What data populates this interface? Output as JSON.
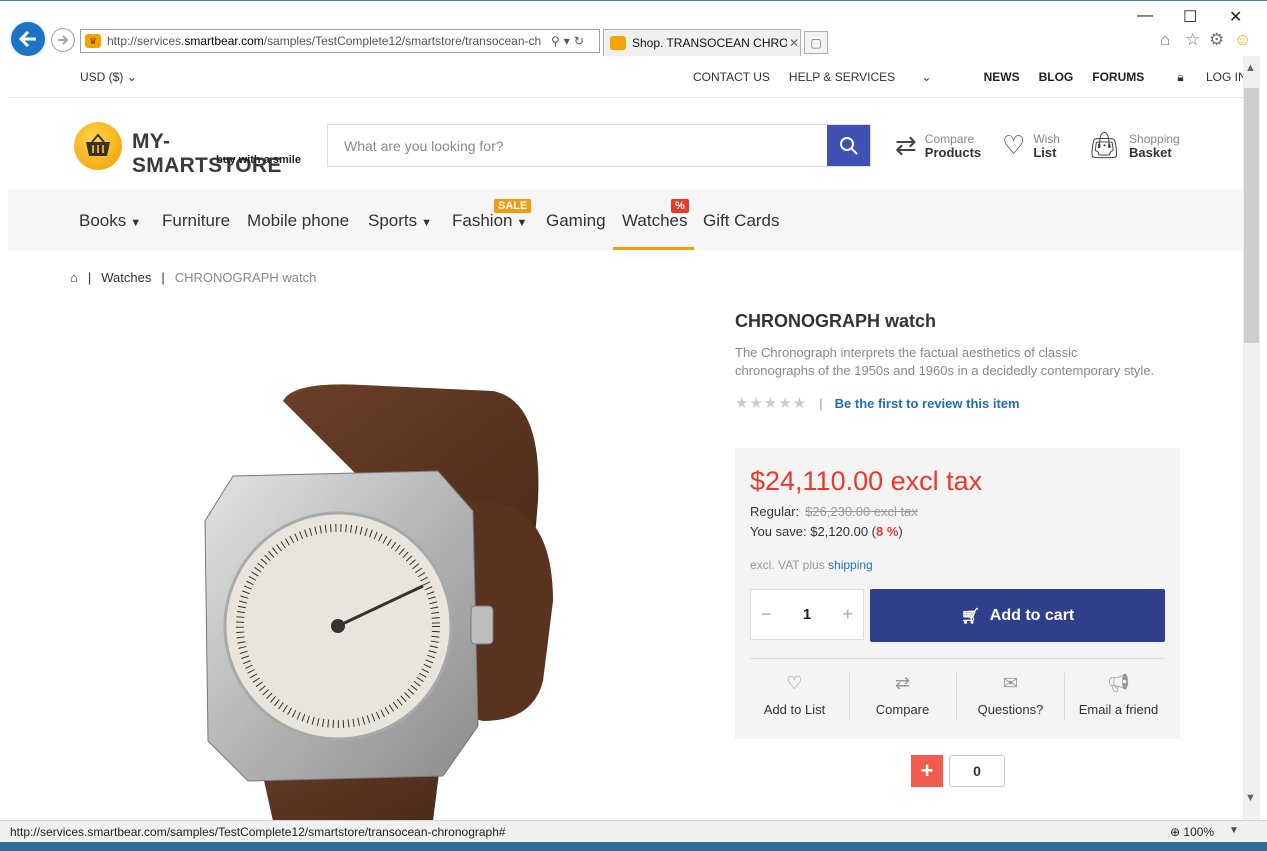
{
  "browser": {
    "url_prefix": "http://services.",
    "url_domain": "smartbear.com",
    "url_rest": "/samples/TestComplete12/smartstore/transocean-ch",
    "tab_title": "Shop. TRANSOCEAN CHRO...",
    "status_url": "http://services.smartbear.com/samples/TestComplete12/smartstore/transocean-chronograph#",
    "zoom": "100%"
  },
  "topbar": {
    "currency": "USD ($)",
    "contact": "CONTACT US",
    "help": "HELP & SERVICES",
    "news": "NEWS",
    "blog": "BLOG",
    "forums": "FORUMS",
    "login": "LOG IN"
  },
  "logo": {
    "name": "MY-SMARTSTORE",
    "tagline": "buy with a smile"
  },
  "search": {
    "placeholder": "What are you looking for?"
  },
  "header_actions": {
    "compare_top": "Compare",
    "compare_bottom": "Products",
    "wish_top": "Wish",
    "wish_bottom": "List",
    "basket_top": "Shopping",
    "basket_bottom": "Basket"
  },
  "categories": {
    "books": "Books",
    "furniture": "Furniture",
    "mobile": "Mobile phone",
    "sports": "Sports",
    "fashion": "Fashion",
    "fashion_badge": "SALE",
    "gaming": "Gaming",
    "watches": "Watches",
    "watches_badge": "%",
    "giftcards": "Gift Cards"
  },
  "breadcrumb": {
    "sep": "|",
    "level1": "Watches",
    "current": "CHRONOGRAPH watch"
  },
  "product": {
    "title": "CHRONOGRAPH watch",
    "description": "The Chronograph interprets the factual aesthetics of classic chronographs of the 1950s and 1960s in a decidedly contemporary style.",
    "stars": "★★★★★",
    "rating": 0,
    "review_link": "Be the first to review this item",
    "price": "$24,110.00 excl tax",
    "regular_label": "Regular:",
    "regular_price": "$26,230.00 excl tax",
    "save_text": "You save: $2,120.00 (",
    "save_pct": "8 %",
    "save_close": ")",
    "vat_text": "excl. VAT plus ",
    "shipping_link": "shipping",
    "quantity": "1",
    "add_to_cart": "Add to cart",
    "add_to_list": "Add to List",
    "compare": "Compare",
    "questions": "Questions?",
    "email_friend": "Email a friend",
    "share_count": "0"
  },
  "colors": {
    "accent": "#3f51b5",
    "cart": "#303f8b",
    "price": "#e8392b",
    "active": "#f39c12",
    "link": "#1e6fb6"
  }
}
